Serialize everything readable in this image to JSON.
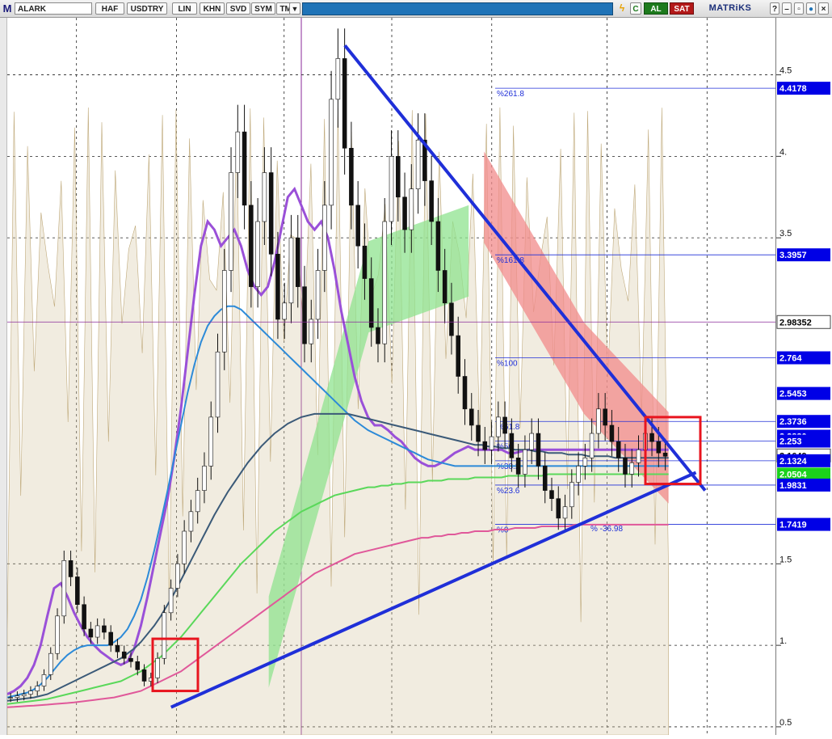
{
  "toolbar": {
    "app_letter": "M",
    "symbol": "ALARK",
    "buttons": [
      "HAF",
      "USDTRY",
      "LIN",
      "KHN",
      "SVD",
      "SYM",
      "TMP"
    ],
    "buy_label": "AL",
    "sell_label": "SAT",
    "brand": "MATRiKS"
  },
  "colors": {
    "toolbar_blue": "#1f73b7",
    "trendline_blue": "#1f2fd8",
    "highlight_red": "#e8141e",
    "ichimoku_green": "#8fe38f",
    "ichimoku_red": "#f28b8b"
  },
  "chart_data": {
    "type": "line",
    "symbol": "ALARK",
    "ylim": [
      0.45,
      4.85
    ],
    "grid": true,
    "axis_ticks": [
      "4.5",
      "4.",
      "3.5",
      "1.5",
      "1.",
      "0.5"
    ],
    "price_labels": [
      {
        "value": 4.4178,
        "text": "4.4178",
        "style": "blue"
      },
      {
        "value": 3.3957,
        "text": "3.3957",
        "style": "blue"
      },
      {
        "value": 2.98352,
        "text": "2.98352",
        "style": "white"
      },
      {
        "value": 2.764,
        "text": "2.764",
        "style": "blue"
      },
      {
        "value": 2.5453,
        "text": "2.5453",
        "style": "blue"
      },
      {
        "value": 2.3736,
        "text": "2.3736",
        "style": "blue"
      },
      {
        "value": 2.283,
        "text": "2.2830",
        "style": "blue"
      },
      {
        "value": 2.253,
        "text": "2.253",
        "style": "blue"
      },
      {
        "value": 2.1649,
        "text": "2.1649",
        "style": "white"
      },
      {
        "value": 2.1324,
        "text": "2.1324",
        "style": "blue"
      },
      {
        "value": 2.0504,
        "text": "2.0504",
        "style": "green"
      },
      {
        "value": 1.9831,
        "text": "1.9831",
        "style": "blue"
      },
      {
        "value": 1.7419,
        "text": "1.7419",
        "style": "blue"
      }
    ],
    "fibonacci": [
      {
        "label": "%261.8",
        "value": 4.4178
      },
      {
        "label": "%161.8",
        "value": 3.3957
      },
      {
        "label": "%100",
        "value": 2.764
      },
      {
        "label": "%61.8",
        "value": 2.3736
      },
      {
        "label": "%50",
        "value": 2.253
      },
      {
        "label": "%38.2",
        "value": 2.1324
      },
      {
        "label": "%23.6",
        "value": 1.9831
      },
      {
        "label": "%0",
        "value": 1.7419
      }
    ],
    "annotation": "% -36.98",
    "close": [
      0.68,
      0.69,
      0.7,
      0.72,
      0.75,
      0.82,
      0.95,
      1.18,
      1.52,
      1.42,
      1.25,
      1.1,
      1.05,
      1.12,
      1.08,
      1.0,
      0.96,
      0.92,
      0.9,
      0.85,
      0.78,
      0.8,
      0.92,
      1.2,
      1.35,
      1.5,
      1.7,
      1.82,
      1.95,
      2.1,
      2.4,
      2.8,
      3.3,
      3.9,
      4.15,
      3.7,
      3.2,
      3.6,
      3.9,
      3.4,
      3.0,
      3.1,
      3.5,
      3.2,
      2.85,
      3.0,
      3.3,
      3.7,
      4.35,
      4.6,
      4.05,
      3.7,
      3.45,
      3.25,
      2.95,
      2.85,
      3.6,
      4.0,
      3.75,
      3.55,
      3.8,
      4.1,
      3.85,
      3.6,
      3.3,
      3.1,
      2.9,
      2.65,
      2.45,
      2.35,
      2.25,
      2.2,
      2.28,
      2.4,
      2.3,
      2.15,
      2.05,
      2.2,
      2.3,
      2.1,
      1.95,
      1.9,
      1.78,
      1.85,
      2.0,
      2.1,
      2.15,
      2.3,
      2.45,
      2.35,
      2.25,
      2.15,
      2.05,
      2.12,
      2.2,
      2.3,
      2.25,
      2.18,
      2.16
    ],
    "series": [
      {
        "values": [
          0.7,
          0.72,
          0.75,
          0.8,
          0.88,
          1.0,
          1.18,
          1.35,
          1.38,
          1.3,
          1.2,
          1.12,
          1.05,
          1.0,
          0.96,
          0.93,
          0.9,
          0.88,
          0.9,
          0.98,
          1.12,
          1.3,
          1.5,
          1.7,
          1.9,
          2.15,
          2.45,
          2.8,
          3.15,
          3.45,
          3.6,
          3.55,
          3.45,
          3.5,
          3.55,
          3.45,
          3.3,
          3.2,
          3.15,
          3.2,
          3.35,
          3.55,
          3.75,
          3.8,
          3.7,
          3.6,
          3.55,
          3.6,
          3.5,
          3.3,
          3.05,
          2.85,
          2.65,
          2.5,
          2.4,
          2.35,
          2.35,
          2.32,
          2.28,
          2.25,
          2.2,
          2.15,
          2.12,
          2.1,
          2.1,
          2.12,
          2.15,
          2.18,
          2.2,
          2.22,
          2.2,
          2.2,
          2.2,
          2.2,
          2.2,
          2.18,
          2.18,
          2.19,
          2.2,
          2.2,
          2.2,
          2.2,
          2.2,
          2.2,
          2.2,
          2.2,
          2.2,
          2.2,
          2.2,
          2.2,
          2.2,
          2.2,
          2.2,
          2.2,
          2.2,
          2.2,
          2.2,
          2.2,
          2.2,
          2.2
        ],
        "color": "#9a50d8"
      },
      {
        "values": [
          0.68,
          0.69,
          0.7,
          0.71,
          0.73,
          0.76,
          0.8,
          0.85,
          0.9,
          0.94,
          0.97,
          0.99,
          1.0,
          1.0,
          1.0,
          1.0,
          1.02,
          1.05,
          1.1,
          1.18,
          1.28,
          1.42,
          1.58,
          1.76,
          1.95,
          2.15,
          2.35,
          2.55,
          2.72,
          2.86,
          2.96,
          3.02,
          3.06,
          3.08,
          3.08,
          3.06,
          3.02,
          2.98,
          2.94,
          2.9,
          2.86,
          2.82,
          2.78,
          2.74,
          2.7,
          2.66,
          2.62,
          2.58,
          2.54,
          2.5,
          2.46,
          2.42,
          2.38,
          2.35,
          2.32,
          2.3,
          2.28,
          2.26,
          2.24,
          2.22,
          2.2,
          2.18,
          2.16,
          2.14,
          2.13,
          2.12,
          2.11,
          2.1,
          2.1,
          2.1,
          2.1,
          2.1,
          2.1,
          2.1,
          2.1,
          2.1,
          2.1,
          2.1,
          2.1,
          2.1,
          2.1,
          2.1,
          2.1,
          2.1,
          2.1,
          2.1,
          2.1,
          2.1,
          2.1,
          2.1,
          2.1,
          2.1,
          2.1,
          2.1,
          2.1,
          2.1,
          2.1,
          2.1,
          2.1,
          2.1
        ],
        "color": "#2c8ad8"
      },
      {
        "values": [
          0.66,
          0.665,
          0.67,
          0.675,
          0.68,
          0.69,
          0.7,
          0.72,
          0.74,
          0.76,
          0.78,
          0.8,
          0.82,
          0.84,
          0.86,
          0.88,
          0.9,
          0.92,
          0.95,
          0.98,
          1.02,
          1.07,
          1.12,
          1.18,
          1.25,
          1.32,
          1.4,
          1.48,
          1.56,
          1.64,
          1.72,
          1.8,
          1.87,
          1.94,
          2.0,
          2.06,
          2.12,
          2.17,
          2.22,
          2.26,
          2.3,
          2.33,
          2.36,
          2.38,
          2.4,
          2.41,
          2.42,
          2.42,
          2.42,
          2.42,
          2.42,
          2.42,
          2.41,
          2.4,
          2.39,
          2.38,
          2.37,
          2.36,
          2.35,
          2.34,
          2.33,
          2.32,
          2.31,
          2.3,
          2.29,
          2.28,
          2.27,
          2.26,
          2.25,
          2.24,
          2.23,
          2.23,
          2.22,
          2.22,
          2.21,
          2.21,
          2.2,
          2.2,
          2.2,
          2.19,
          2.19,
          2.18,
          2.18,
          2.18,
          2.17,
          2.17,
          2.17,
          2.16,
          2.16,
          2.16,
          2.16,
          2.15,
          2.15,
          2.15,
          2.15,
          2.15,
          2.15,
          2.15,
          2.15,
          2.15
        ],
        "color": "#3b5a78"
      },
      {
        "values": [
          0.64,
          0.645,
          0.65,
          0.655,
          0.66,
          0.665,
          0.67,
          0.68,
          0.69,
          0.7,
          0.71,
          0.72,
          0.73,
          0.74,
          0.75,
          0.76,
          0.77,
          0.78,
          0.8,
          0.82,
          0.84,
          0.87,
          0.9,
          0.93,
          0.97,
          1.01,
          1.05,
          1.1,
          1.15,
          1.2,
          1.25,
          1.3,
          1.35,
          1.4,
          1.45,
          1.5,
          1.54,
          1.58,
          1.62,
          1.66,
          1.7,
          1.73,
          1.76,
          1.79,
          1.82,
          1.84,
          1.86,
          1.88,
          1.9,
          1.92,
          1.93,
          1.94,
          1.95,
          1.96,
          1.97,
          1.97,
          1.98,
          1.98,
          1.99,
          1.99,
          2.0,
          2.0,
          2.0,
          2.01,
          2.01,
          2.01,
          2.02,
          2.02,
          2.02,
          2.02,
          2.03,
          2.03,
          2.03,
          2.03,
          2.03,
          2.04,
          2.04,
          2.04,
          2.04,
          2.04,
          2.04,
          2.05,
          2.05,
          2.05,
          2.05,
          2.05,
          2.05,
          2.05,
          2.05,
          2.05,
          2.05,
          2.05,
          2.05,
          2.05,
          2.05,
          2.05,
          2.05,
          2.05,
          2.05,
          2.05
        ],
        "color": "#5ad85a"
      },
      {
        "values": [
          0.62,
          0.622,
          0.625,
          0.628,
          0.63,
          0.633,
          0.636,
          0.64,
          0.643,
          0.646,
          0.65,
          0.655,
          0.66,
          0.665,
          0.67,
          0.675,
          0.68,
          0.69,
          0.7,
          0.71,
          0.72,
          0.74,
          0.76,
          0.78,
          0.8,
          0.82,
          0.84,
          0.87,
          0.9,
          0.93,
          0.96,
          0.99,
          1.02,
          1.05,
          1.08,
          1.11,
          1.14,
          1.17,
          1.2,
          1.23,
          1.26,
          1.29,
          1.32,
          1.35,
          1.38,
          1.41,
          1.44,
          1.46,
          1.48,
          1.5,
          1.52,
          1.54,
          1.56,
          1.57,
          1.58,
          1.59,
          1.6,
          1.61,
          1.62,
          1.63,
          1.64,
          1.65,
          1.66,
          1.66,
          1.67,
          1.67,
          1.68,
          1.68,
          1.69,
          1.69,
          1.7,
          1.7,
          1.7,
          1.71,
          1.71,
          1.71,
          1.72,
          1.72,
          1.72,
          1.72,
          1.73,
          1.73,
          1.73,
          1.73,
          1.73,
          1.74,
          1.74,
          1.74,
          1.74,
          1.74,
          1.74,
          1.74,
          1.74,
          1.74,
          1.74,
          1.74,
          1.74,
          1.74,
          1.74,
          1.74
        ],
        "color": "#e0589a"
      }
    ],
    "trendline_points": [
      [
        0.25,
        4.68
      ],
      [
        0.96,
        1.95
      ]
    ],
    "support_points": [
      [
        0.213,
        0.62
      ],
      [
        0.906,
        2.06
      ]
    ],
    "cloud_green": [
      [
        0.34,
        1.02
      ],
      [
        0.47,
        3.2
      ],
      [
        0.6,
        3.42
      ]
    ],
    "cloud_red": [
      [
        0.62,
        3.75
      ],
      [
        0.75,
        2.7
      ],
      [
        0.86,
        2.15
      ]
    ]
  }
}
